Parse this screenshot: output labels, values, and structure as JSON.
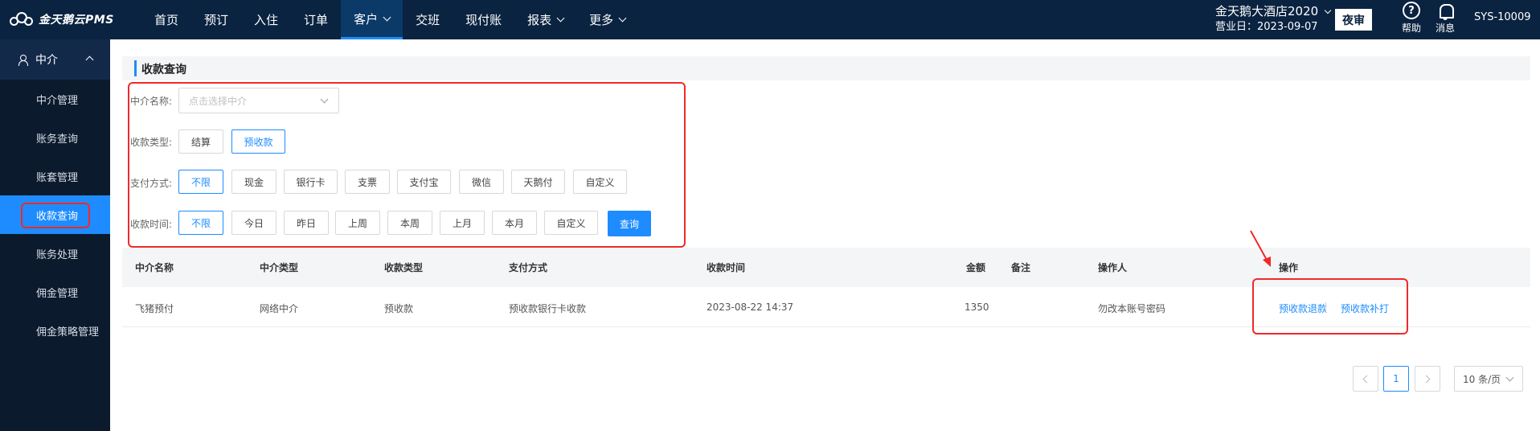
{
  "app": {
    "logo_text": "金天鹅云PMS",
    "nav": [
      {
        "label": "首页",
        "has_chevron": false
      },
      {
        "label": "预订",
        "has_chevron": false
      },
      {
        "label": "入住",
        "has_chevron": false
      },
      {
        "label": "订单",
        "has_chevron": false
      },
      {
        "label": "客户",
        "has_chevron": true,
        "active": true
      },
      {
        "label": "交班",
        "has_chevron": false
      },
      {
        "label": "现付账",
        "has_chevron": false
      },
      {
        "label": "报表",
        "has_chevron": true
      },
      {
        "label": "更多",
        "has_chevron": true
      }
    ],
    "hotel_name": "金天鹅大酒店2020",
    "business_date": "营业日：2023-09-07",
    "night_audit_label": "夜审",
    "help_label": "帮助",
    "help_glyph": "?",
    "message_label": "消息",
    "user_label": "SYS-10009",
    "colors": {
      "topbar": "#0a2340",
      "accent": "#1e8cff",
      "sidebar": "#0b1a2c",
      "highlight": "#f02a2a"
    }
  },
  "sidebar": {
    "group_label": "中介",
    "items": [
      {
        "label": "中介管理"
      },
      {
        "label": "账务查询"
      },
      {
        "label": "账套管理"
      },
      {
        "label": "收款查询",
        "active": true
      },
      {
        "label": "账务处理"
      },
      {
        "label": "佣金管理"
      },
      {
        "label": "佣金策略管理"
      }
    ]
  },
  "page": {
    "title": "收款查询"
  },
  "filters": {
    "agent_name_label": "中介名称:",
    "agent_name_placeholder": "点击选择中介",
    "payment_type_label": "收款类型:",
    "payment_types": [
      {
        "label": "结算",
        "selected": false
      },
      {
        "label": "预收款",
        "selected": true
      }
    ],
    "pay_method_label": "支付方式:",
    "pay_methods": [
      {
        "label": "不限",
        "selected": true
      },
      {
        "label": "现金",
        "selected": false
      },
      {
        "label": "银行卡",
        "selected": false
      },
      {
        "label": "支票",
        "selected": false
      },
      {
        "label": "支付宝",
        "selected": false
      },
      {
        "label": "微信",
        "selected": false
      },
      {
        "label": "天鹅付",
        "selected": false
      },
      {
        "label": "自定义",
        "selected": false
      }
    ],
    "time_label": "收款时间:",
    "times": [
      {
        "label": "不限",
        "selected": true
      },
      {
        "label": "今日",
        "selected": false
      },
      {
        "label": "昨日",
        "selected": false
      },
      {
        "label": "上周",
        "selected": false
      },
      {
        "label": "本周",
        "selected": false
      },
      {
        "label": "上月",
        "selected": false
      },
      {
        "label": "本月",
        "selected": false
      },
      {
        "label": "自定义",
        "selected": false
      }
    ],
    "query_label": "查询"
  },
  "table": {
    "headers": {
      "agent_name": "中介名称",
      "agent_type": "中介类型",
      "payment_type": "收款类型",
      "pay_method": "支付方式",
      "time": "收款时间",
      "amount": "金额",
      "remark": "备注",
      "operator": "操作人",
      "actions": "操作"
    },
    "rows": [
      {
        "agent_name": "飞猪预付",
        "agent_type": "网络中介",
        "payment_type": "预收款",
        "pay_method": "预收款银行卡收款",
        "time": "2023-08-22 14:37",
        "amount": "1350",
        "remark": "",
        "operator": "勿改本账号密码",
        "action_refund": "预收款退款",
        "action_reprint": "预收款补打"
      }
    ]
  },
  "pagination": {
    "current_page": "1",
    "page_size": "10 条/页"
  }
}
